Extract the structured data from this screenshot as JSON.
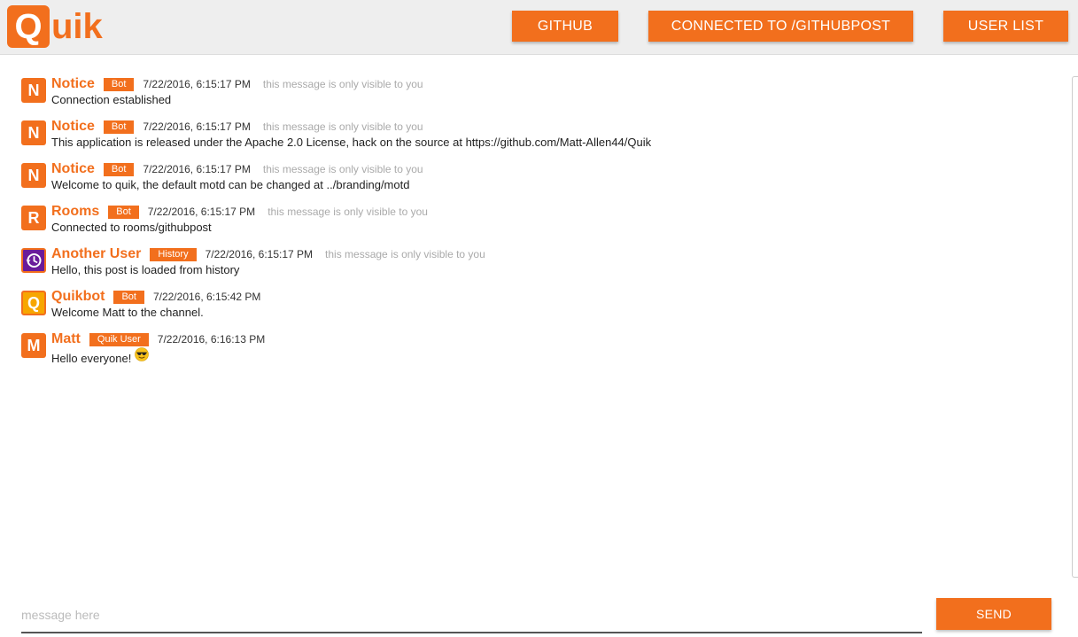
{
  "header": {
    "logo_initial": "Q",
    "logo_rest": "uik",
    "buttons": {
      "github": "GITHUB",
      "connected": "CONNECTED TO /GITHUBPOST",
      "user_list": "USER LIST"
    }
  },
  "colors": {
    "accent": "#f26f1d",
    "header_bg": "#eeeeee",
    "private_note": "#aaaaaa",
    "history_avatar": "#6a1b9a",
    "quikbot_avatar": "#f7a600"
  },
  "messages": [
    {
      "avatar": "N",
      "avatar_icon": "letter-avatar",
      "name": "Notice",
      "badge": "Bot",
      "time": "7/22/2016, 6:15:17 PM",
      "note": "this message is only visible to you",
      "text": "Connection established"
    },
    {
      "avatar": "N",
      "avatar_icon": "letter-avatar",
      "name": "Notice",
      "badge": "Bot",
      "time": "7/22/2016, 6:15:17 PM",
      "note": "this message is only visible to you",
      "text": "This application is released under the Apache 2.0 License, hack on the source at https://github.com/Matt-Allen44/Quik"
    },
    {
      "avatar": "N",
      "avatar_icon": "letter-avatar",
      "name": "Notice",
      "badge": "Bot",
      "time": "7/22/2016, 6:15:17 PM",
      "note": "this message is only visible to you",
      "text": "Welcome to quik, the default motd can be changed at ../branding/motd"
    },
    {
      "avatar": "R",
      "avatar_icon": "letter-avatar",
      "name": "Rooms",
      "badge": "Bot",
      "time": "7/22/2016, 6:15:17 PM",
      "note": "this message is only visible to you",
      "text": "Connected to rooms/githubpost"
    },
    {
      "avatar": "",
      "avatar_icon": "history-icon",
      "name": "Another User",
      "badge": "History",
      "time": "7/22/2016, 6:15:17 PM",
      "note": "this message is only visible to you",
      "text": "Hello, this post is loaded from history"
    },
    {
      "avatar": "Q",
      "avatar_icon": "letter-avatar",
      "name": "Quikbot",
      "badge": "Bot",
      "time": "7/22/2016, 6:15:42 PM",
      "note": "",
      "text": "Welcome Matt to the channel."
    },
    {
      "avatar": "M",
      "avatar_icon": "letter-avatar",
      "name": "Matt",
      "badge": "Quik User",
      "time": "7/22/2016, 6:16:13 PM",
      "note": "",
      "text": "Hello everyone!",
      "emoji": "sunglasses-emoji-icon"
    }
  ],
  "composer": {
    "placeholder": "message here",
    "value": "",
    "send_label": "SEND"
  }
}
